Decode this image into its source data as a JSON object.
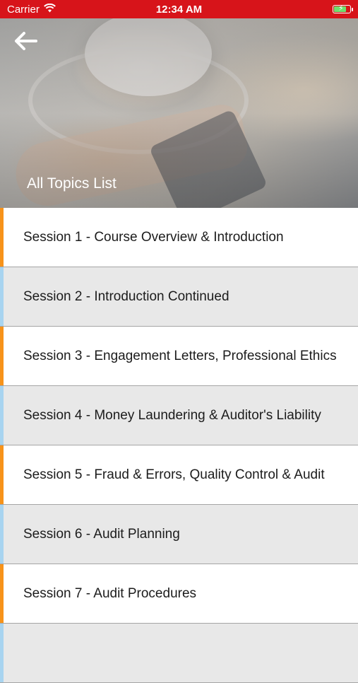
{
  "status_bar": {
    "carrier": "Carrier",
    "time": "12:34 AM",
    "color": "#d7141a"
  },
  "header": {
    "back_icon": "arrow-left-icon",
    "title": "All Topics List"
  },
  "sessions": [
    {
      "label": "Session 1 - Course Overview  & Introduction"
    },
    {
      "label": "Session 2 - Introduction Continued"
    },
    {
      "label": "Session 3 - Engagement Letters, Professional Ethics"
    },
    {
      "label": "Session 4 - Money Laundering & Auditor's Liability"
    },
    {
      "label": "Session 5 - Fraud & Errors, Quality Control & Audit"
    },
    {
      "label": "Session 6 - Audit Planning"
    },
    {
      "label": "Session 7 - Audit Procedures"
    },
    {
      "label": ""
    }
  ],
  "colors": {
    "accent_odd": "#f7931a",
    "accent_even": "#a8d4f0",
    "row_odd_bg": "#ffffff",
    "row_even_bg": "#e8e8e8"
  }
}
